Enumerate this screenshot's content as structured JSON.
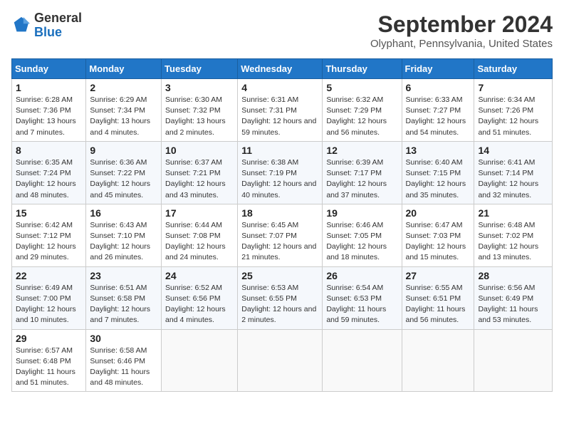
{
  "header": {
    "logo_line1": "General",
    "logo_line2": "Blue",
    "month_title": "September 2024",
    "subtitle": "Olyphant, Pennsylvania, United States"
  },
  "weekdays": [
    "Sunday",
    "Monday",
    "Tuesday",
    "Wednesday",
    "Thursday",
    "Friday",
    "Saturday"
  ],
  "weeks": [
    [
      {
        "day": "1",
        "sunrise": "Sunrise: 6:28 AM",
        "sunset": "Sunset: 7:36 PM",
        "daylight": "Daylight: 13 hours and 7 minutes."
      },
      {
        "day": "2",
        "sunrise": "Sunrise: 6:29 AM",
        "sunset": "Sunset: 7:34 PM",
        "daylight": "Daylight: 13 hours and 4 minutes."
      },
      {
        "day": "3",
        "sunrise": "Sunrise: 6:30 AM",
        "sunset": "Sunset: 7:32 PM",
        "daylight": "Daylight: 13 hours and 2 minutes."
      },
      {
        "day": "4",
        "sunrise": "Sunrise: 6:31 AM",
        "sunset": "Sunset: 7:31 PM",
        "daylight": "Daylight: 12 hours and 59 minutes."
      },
      {
        "day": "5",
        "sunrise": "Sunrise: 6:32 AM",
        "sunset": "Sunset: 7:29 PM",
        "daylight": "Daylight: 12 hours and 56 minutes."
      },
      {
        "day": "6",
        "sunrise": "Sunrise: 6:33 AM",
        "sunset": "Sunset: 7:27 PM",
        "daylight": "Daylight: 12 hours and 54 minutes."
      },
      {
        "day": "7",
        "sunrise": "Sunrise: 6:34 AM",
        "sunset": "Sunset: 7:26 PM",
        "daylight": "Daylight: 12 hours and 51 minutes."
      }
    ],
    [
      {
        "day": "8",
        "sunrise": "Sunrise: 6:35 AM",
        "sunset": "Sunset: 7:24 PM",
        "daylight": "Daylight: 12 hours and 48 minutes."
      },
      {
        "day": "9",
        "sunrise": "Sunrise: 6:36 AM",
        "sunset": "Sunset: 7:22 PM",
        "daylight": "Daylight: 12 hours and 45 minutes."
      },
      {
        "day": "10",
        "sunrise": "Sunrise: 6:37 AM",
        "sunset": "Sunset: 7:21 PM",
        "daylight": "Daylight: 12 hours and 43 minutes."
      },
      {
        "day": "11",
        "sunrise": "Sunrise: 6:38 AM",
        "sunset": "Sunset: 7:19 PM",
        "daylight": "Daylight: 12 hours and 40 minutes."
      },
      {
        "day": "12",
        "sunrise": "Sunrise: 6:39 AM",
        "sunset": "Sunset: 7:17 PM",
        "daylight": "Daylight: 12 hours and 37 minutes."
      },
      {
        "day": "13",
        "sunrise": "Sunrise: 6:40 AM",
        "sunset": "Sunset: 7:15 PM",
        "daylight": "Daylight: 12 hours and 35 minutes."
      },
      {
        "day": "14",
        "sunrise": "Sunrise: 6:41 AM",
        "sunset": "Sunset: 7:14 PM",
        "daylight": "Daylight: 12 hours and 32 minutes."
      }
    ],
    [
      {
        "day": "15",
        "sunrise": "Sunrise: 6:42 AM",
        "sunset": "Sunset: 7:12 PM",
        "daylight": "Daylight: 12 hours and 29 minutes."
      },
      {
        "day": "16",
        "sunrise": "Sunrise: 6:43 AM",
        "sunset": "Sunset: 7:10 PM",
        "daylight": "Daylight: 12 hours and 26 minutes."
      },
      {
        "day": "17",
        "sunrise": "Sunrise: 6:44 AM",
        "sunset": "Sunset: 7:08 PM",
        "daylight": "Daylight: 12 hours and 24 minutes."
      },
      {
        "day": "18",
        "sunrise": "Sunrise: 6:45 AM",
        "sunset": "Sunset: 7:07 PM",
        "daylight": "Daylight: 12 hours and 21 minutes."
      },
      {
        "day": "19",
        "sunrise": "Sunrise: 6:46 AM",
        "sunset": "Sunset: 7:05 PM",
        "daylight": "Daylight: 12 hours and 18 minutes."
      },
      {
        "day": "20",
        "sunrise": "Sunrise: 6:47 AM",
        "sunset": "Sunset: 7:03 PM",
        "daylight": "Daylight: 12 hours and 15 minutes."
      },
      {
        "day": "21",
        "sunrise": "Sunrise: 6:48 AM",
        "sunset": "Sunset: 7:02 PM",
        "daylight": "Daylight: 12 hours and 13 minutes."
      }
    ],
    [
      {
        "day": "22",
        "sunrise": "Sunrise: 6:49 AM",
        "sunset": "Sunset: 7:00 PM",
        "daylight": "Daylight: 12 hours and 10 minutes."
      },
      {
        "day": "23",
        "sunrise": "Sunrise: 6:51 AM",
        "sunset": "Sunset: 6:58 PM",
        "daylight": "Daylight: 12 hours and 7 minutes."
      },
      {
        "day": "24",
        "sunrise": "Sunrise: 6:52 AM",
        "sunset": "Sunset: 6:56 PM",
        "daylight": "Daylight: 12 hours and 4 minutes."
      },
      {
        "day": "25",
        "sunrise": "Sunrise: 6:53 AM",
        "sunset": "Sunset: 6:55 PM",
        "daylight": "Daylight: 12 hours and 2 minutes."
      },
      {
        "day": "26",
        "sunrise": "Sunrise: 6:54 AM",
        "sunset": "Sunset: 6:53 PM",
        "daylight": "Daylight: 11 hours and 59 minutes."
      },
      {
        "day": "27",
        "sunrise": "Sunrise: 6:55 AM",
        "sunset": "Sunset: 6:51 PM",
        "daylight": "Daylight: 11 hours and 56 minutes."
      },
      {
        "day": "28",
        "sunrise": "Sunrise: 6:56 AM",
        "sunset": "Sunset: 6:49 PM",
        "daylight": "Daylight: 11 hours and 53 minutes."
      }
    ],
    [
      {
        "day": "29",
        "sunrise": "Sunrise: 6:57 AM",
        "sunset": "Sunset: 6:48 PM",
        "daylight": "Daylight: 11 hours and 51 minutes."
      },
      {
        "day": "30",
        "sunrise": "Sunrise: 6:58 AM",
        "sunset": "Sunset: 6:46 PM",
        "daylight": "Daylight: 11 hours and 48 minutes."
      },
      null,
      null,
      null,
      null,
      null
    ]
  ]
}
